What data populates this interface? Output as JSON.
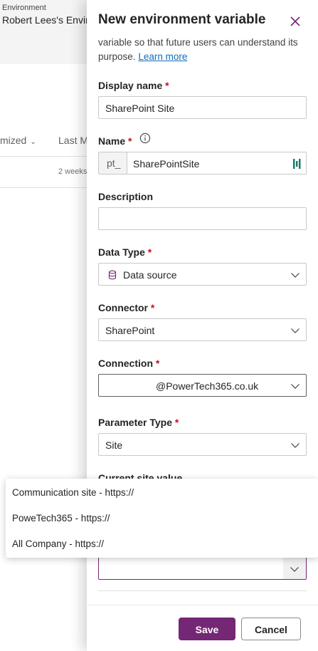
{
  "environment": {
    "label": "Environment",
    "name": "Robert Lees's Enviro"
  },
  "table": {
    "columns": [
      {
        "label": "mized"
      },
      {
        "label": "Last M"
      }
    ],
    "rows": [
      {
        "modified": "2 weeks"
      }
    ]
  },
  "panel": {
    "title": "New environment variable",
    "intro_text": "variable so that future users can understand its purpose.",
    "learn_more": "Learn more",
    "required_mark": "*",
    "display_name": {
      "label": "Display name",
      "value": "SharePoint Site"
    },
    "name": {
      "label": "Name",
      "prefix": "pt_",
      "value": "SharePointSite"
    },
    "description": {
      "label": "Description",
      "value": ""
    },
    "data_type": {
      "label": "Data Type",
      "value": "Data source"
    },
    "connector": {
      "label": "Connector",
      "value": "SharePoint"
    },
    "connection": {
      "label": "Connection",
      "value": "@PowerTech365.co.uk"
    },
    "parameter_type": {
      "label": "Parameter Type",
      "value": "Site"
    },
    "current_site": {
      "label": "Current site value",
      "value": ""
    },
    "buttons": {
      "save": "Save",
      "cancel": "Cancel"
    }
  },
  "dropdown_options": [
    "Communication site - https://",
    "PoweTech365 - https://",
    "All Company - https://"
  ],
  "colors": {
    "accent": "#742774",
    "required": "#c50f1f",
    "link": "#0f6cbd"
  }
}
